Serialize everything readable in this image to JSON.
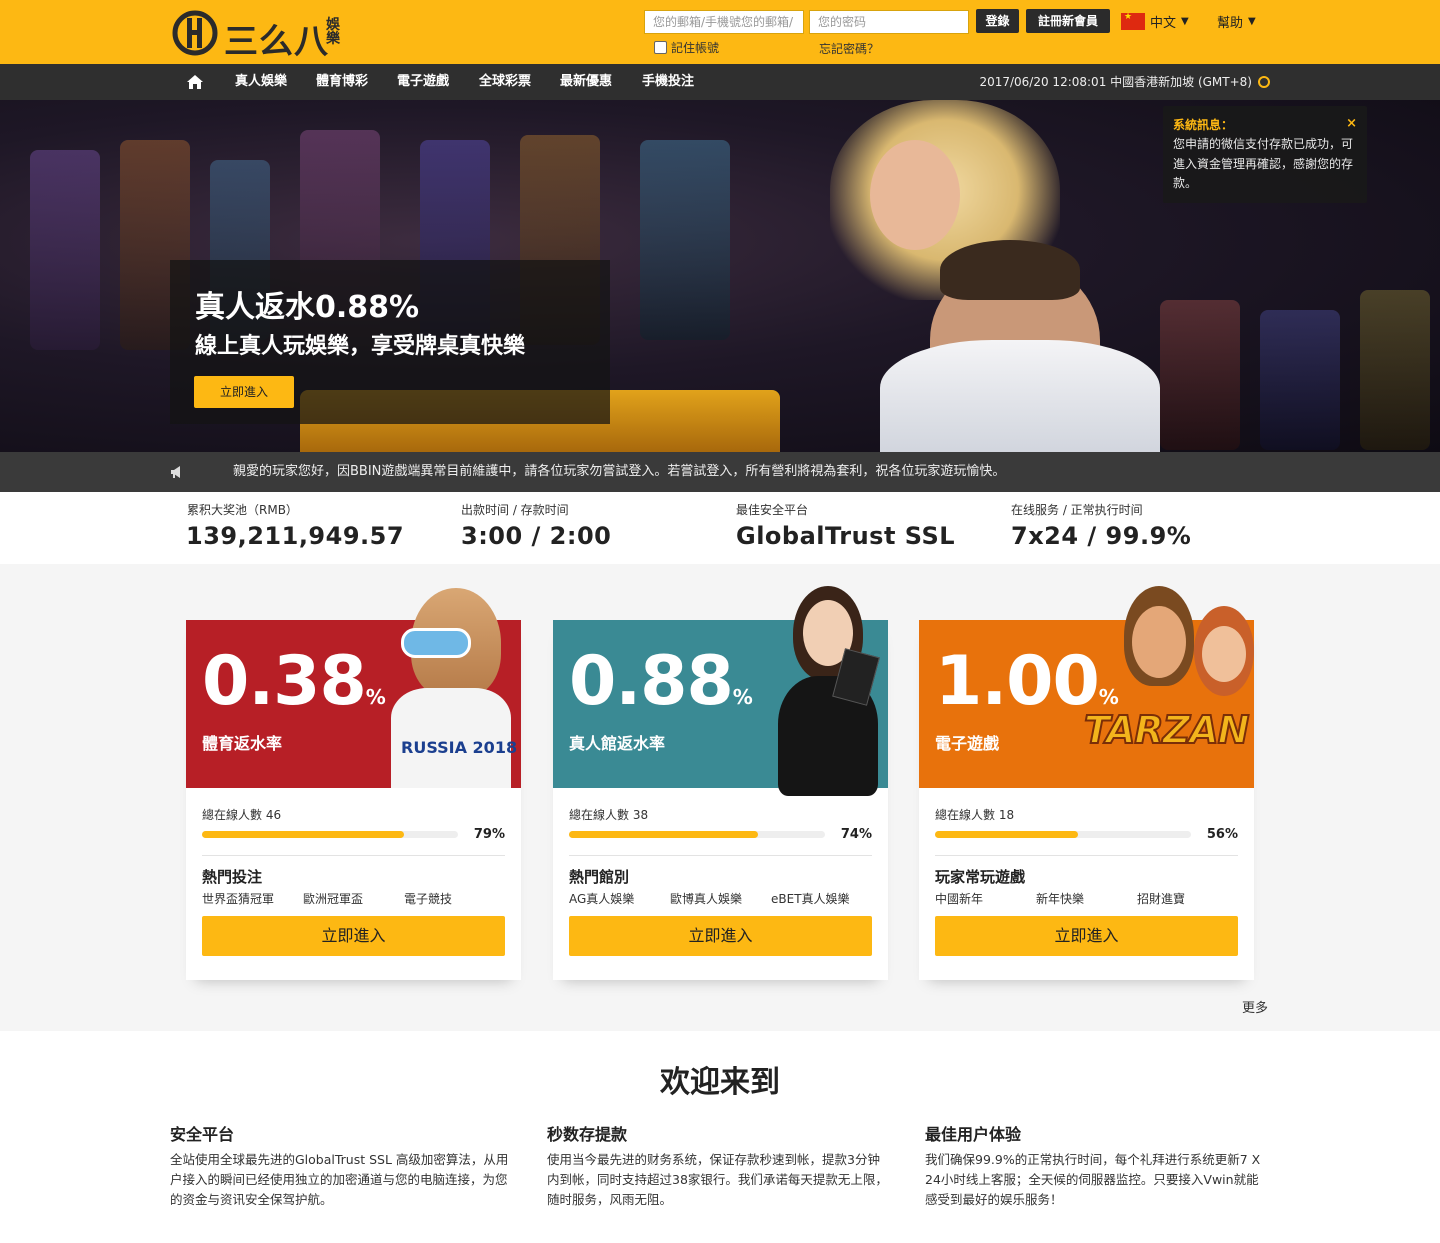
{
  "header": {
    "logo_text": "三么八",
    "logo_sub": "娛樂",
    "email_placeholder": "您的郵箱/手機號您的郵箱/",
    "password_placeholder": "您的密码",
    "login_label": "登錄",
    "register_label": "註冊新會員",
    "remember_label": "記住帳號",
    "forgot_label": "忘記密碼？",
    "language": "中文",
    "help_label": "幫助",
    "brand_color": "#fdb813"
  },
  "nav": {
    "items": [
      "真人娛樂",
      "體育博彩",
      "電子遊戲",
      "全球彩票",
      "最新優惠",
      "手機投注"
    ],
    "clock": "2017/06/20 12:08:01 中國香港新加坡 (GMT+8)"
  },
  "hero": {
    "title": "真人返水0.88%",
    "subtitle": "線上真人玩娛樂，享受牌桌真快樂",
    "button": "立即進入",
    "notice_title": "系統訊息：",
    "notice_body": "您申請的微信支付存款已成功，可進入資金管理再確認，感謝您的存款。",
    "notice_close": "×"
  },
  "marquee": {
    "text": "親愛的玩家您好，因BBIN遊戲端異常目前維護中，請各位玩家勿嘗試登入。若嘗試登入，所有營利將視為套利，祝各位玩家遊玩愉快。"
  },
  "stats": [
    {
      "label": "累积大奖池（RMB）",
      "value": "139,211,949.57"
    },
    {
      "label": "出款时间 / 存款时间",
      "value": "3:00 / 2:00"
    },
    {
      "label": "最佳安全平台",
      "value": "GlobalTrust SSL"
    },
    {
      "label": "在线服务 / 正常执行时间",
      "value": "7x24 / 99.9%"
    }
  ],
  "cards": [
    {
      "rate": "0.38",
      "pct_sign": "%",
      "name": "體育返水率",
      "color": "#b71f26",
      "online_label": "總在線人數 46",
      "percent": 79,
      "percent_label": "79%",
      "hot_title": "熱門投注",
      "links": [
        "世界盃猜冠軍",
        "歐洲冠軍盃",
        "電子競技"
      ],
      "button": "立即進入",
      "mascot_text": "RUSSIA 2018"
    },
    {
      "rate": "0.88",
      "pct_sign": "%",
      "name": "真人館返水率",
      "color": "#3a8a94",
      "online_label": "總在線人數 38",
      "percent": 74,
      "percent_label": "74%",
      "hot_title": "熱門館別",
      "links": [
        "AG真人娛樂",
        "歐博真人娛樂",
        "eBET真人娛樂"
      ],
      "button": "立即進入"
    },
    {
      "rate": "1.00",
      "pct_sign": "%",
      "name": "電子遊戲",
      "color": "#e8720c",
      "online_label": "總在線人數 18",
      "percent": 56,
      "percent_label": "56%",
      "hot_title": "玩家常玩遊戲",
      "links": [
        "中國新年",
        "新年快樂",
        "招財進寶"
      ],
      "button": "立即進入",
      "mascot_text": "TARZAN"
    }
  ],
  "more_label": "更多",
  "welcome": {
    "title": "欢迎来到",
    "features": [
      {
        "title": "安全平台",
        "body": "全站使用全球最先进的GlobalTrust SSL 高级加密算法，从用户接入的瞬间已经使用独立的加密通道与您的电脑连接，为您的资金与资讯安全保驾护航。"
      },
      {
        "title": "秒数存提款",
        "body": "使用当今最先进的财务系统，保证存款秒速到帐，提款3分钟内到帐，同时支持超过38家银行。我们承诺每天提款无上限，随时服务，风雨无阻。"
      },
      {
        "title": "最佳用户体验",
        "body": "我们确保99.9%的正常执行时间，每个礼拜进行系统更新7 X 24小时线上客服；全天候的伺服器监控。只要接入Vwin就能感受到最好的娱乐服务！"
      }
    ]
  }
}
